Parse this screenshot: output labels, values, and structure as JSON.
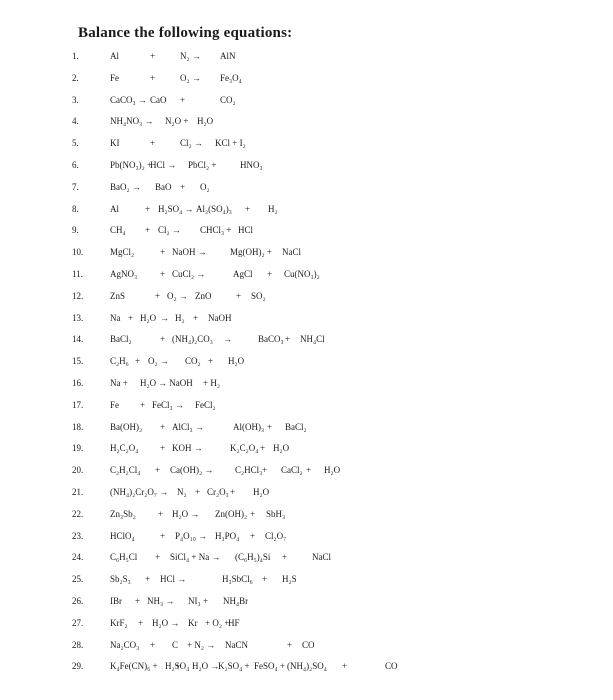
{
  "title": "Balance the following equations:",
  "equations": [
    {
      "n": "1.",
      "terms": [
        "Al",
        "+",
        "N₂ →",
        "AlN"
      ]
    },
    {
      "n": "2.",
      "terms": [
        "Fe",
        "+",
        "O₂ →",
        "Fe₃O₄"
      ]
    },
    {
      "n": "3.",
      "terms": [
        "CaCO₃ →",
        "CaO",
        "+",
        "CO₂"
      ]
    },
    {
      "n": "4.",
      "terms": [
        "NH₄NO₃ →",
        "N₂O +",
        "H₂O"
      ]
    },
    {
      "n": "5.",
      "terms": [
        "KI",
        "+",
        "Cl₂ →",
        "KCl + I₂"
      ]
    },
    {
      "n": "6.",
      "terms": [
        "Pb(NO₃)₂ +",
        "HCl →",
        "PbCl₂ +",
        "HNO₃"
      ]
    },
    {
      "n": "7.",
      "terms": [
        "BaO₂ →",
        "BaO",
        "+",
        "O₂"
      ]
    },
    {
      "n": "8.",
      "terms": [
        "Al",
        "+",
        "H₂SO₄ →",
        "Al₂(SO₄)₃",
        "+",
        "H₂"
      ]
    },
    {
      "n": "9.",
      "terms": [
        "CH₄",
        "+",
        "Cl₂ →",
        "CHCl₃ +",
        "HCl"
      ]
    },
    {
      "n": "10.",
      "terms": [
        "MgCl₂",
        "+",
        "NaOH →",
        "Mg(OH)₂ +",
        "NaCl"
      ]
    },
    {
      "n": "11.",
      "terms": [
        "AgNO₃",
        "+",
        "CuCl₂ →",
        "AgCl",
        "+",
        "Cu(NO₃)₂"
      ]
    },
    {
      "n": "12.",
      "terms": [
        "ZnS",
        "+",
        "O₂ →",
        "ZnO",
        "+",
        "SO₂"
      ]
    },
    {
      "n": "13.",
      "terms": [
        "Na",
        "+",
        "H₂O",
        "→",
        "H₂",
        "+",
        "NaOH"
      ]
    },
    {
      "n": "14.",
      "terms": [
        "BaCl₂",
        "+",
        "(NH₄)₂CO₃",
        "→",
        "BaCO₃",
        "+",
        "NH₄Cl"
      ]
    },
    {
      "n": "15.",
      "terms": [
        "C₂H₆",
        "+",
        "O₂ →",
        "CO₂",
        "+",
        "H₂O"
      ]
    },
    {
      "n": "16.",
      "terms": [
        "Na +",
        "H₂O",
        "→ NaOH",
        "+ H₂"
      ]
    },
    {
      "n": "17.",
      "terms": [
        "Fe",
        "+",
        "FeCl₃ →",
        "FeCl₂"
      ]
    },
    {
      "n": "18.",
      "terms": [
        "Ba(OH)₂",
        "+",
        "AlCl₃ →",
        "Al(OH)₃",
        "+",
        "BaCl₂"
      ]
    },
    {
      "n": "19.",
      "terms": [
        "H₂C₂O₄",
        "+",
        "KOH →",
        "K₂C₂O₄",
        "+",
        "H₂O"
      ]
    },
    {
      "n": "20.",
      "terms": [
        "C₂H₂Cl₄",
        "+",
        "Ca(OH)₂ →",
        "C₂HCl₃",
        "+",
        "CaCl₂",
        "+",
        "H₂O"
      ]
    },
    {
      "n": "21.",
      "terms": [
        "(NH₄)₂Cr₂O₇ →",
        "N₂",
        "+",
        "Cr₂O₃",
        "+",
        "H₂O"
      ]
    },
    {
      "n": "22.",
      "terms": [
        "Zn₃Sb₂",
        "+",
        "H₂O →",
        "Zn(OH)₂",
        "+",
        "SbH₃"
      ]
    },
    {
      "n": "23.",
      "terms": [
        "HClO₄",
        "+",
        "P₄O₁₀ →",
        "H₃PO₄",
        "+",
        "Cl₂O₇"
      ]
    },
    {
      "n": "24.",
      "terms": [
        "C₆H₅Cl",
        "+",
        "SiCl₄ + Na →",
        "(C₆H₅)₄Si",
        "+",
        "NaCl"
      ]
    },
    {
      "n": "25.",
      "terms": [
        "Sb₂S₃",
        "+",
        "HCl →",
        "H₃SbCl₆",
        "+",
        "H₂S"
      ]
    },
    {
      "n": "26.",
      "terms": [
        "IBr",
        "+",
        "NH₃ →",
        "NI₃",
        "+",
        "NH₄Br"
      ]
    },
    {
      "n": "27.",
      "terms": [
        "KrF₂",
        "+",
        "H₂O →",
        "Kr",
        "+ O₂ +",
        "HF"
      ]
    },
    {
      "n": "28.",
      "terms": [
        "Na₂CO₃",
        "+",
        "C",
        "+ N₂ →",
        "NaCN",
        "+",
        "CO"
      ]
    },
    {
      "n": "29.",
      "terms": [
        "K₄Fe(CN)₆ +",
        "H₂SO₄",
        "+",
        "H₂O →",
        "K₂SO₄ +",
        "FeSO₄ +",
        "(NH₄)₂SO₄",
        "+",
        "CO"
      ]
    }
  ]
}
